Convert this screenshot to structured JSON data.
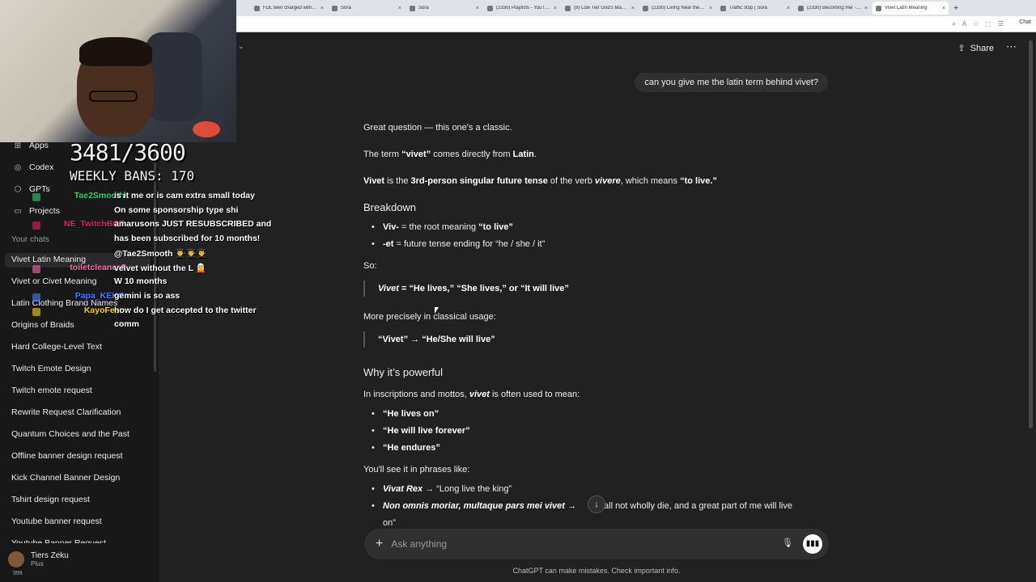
{
  "browser": {
    "tabs": [
      {
        "title": "FDL teen charged with cl…",
        "active": false
      },
      {
        "title": "Sora",
        "active": false
      },
      {
        "title": "Sora",
        "active": false
      },
      {
        "title": "(2330) Playlists - YouTube",
        "active": false
      },
      {
        "title": "(8) Low Tier God's Mansi…",
        "active": false
      },
      {
        "title": "(2330) Living Near the M…",
        "active": false
      },
      {
        "title": "Traffic stop | Sora",
        "active": false
      },
      {
        "title": "(2330) Becoming Her - Ca…",
        "active": false
      },
      {
        "title": "Vivet Latin Meaning",
        "active": true
      }
    ],
    "chat_button": "Chat"
  },
  "sidebar": {
    "nav": [
      {
        "label": "Apps",
        "icon": "apps-icon"
      },
      {
        "label": "Codex",
        "icon": "codex-icon"
      },
      {
        "label": "GPTs",
        "icon": "gpts-icon"
      },
      {
        "label": "Projects",
        "icon": "folder-icon"
      }
    ],
    "section_header": "Your chats",
    "chats": [
      "Vivet Latin Meaning",
      "Vivet or Civet Meaning",
      "Latin Clothing Brand Names",
      "Origins of Braids",
      "Hard College-Level Text",
      "Twitch Emote Design",
      "Twitch emote request",
      "Rewrite Request Clarification",
      "Quantum Choices and the Past",
      "Offline banner design request",
      "Kick Channel Banner Design",
      "Tshirt design request",
      "Youtube banner request",
      "Youtube Banner Request"
    ],
    "user": {
      "name": "Tiers Zeku",
      "plan": "Plus",
      "badge": "999"
    }
  },
  "overlay": {
    "ban_count": "3481/3600",
    "weekly_bans": "WEEKLY BANS: 170",
    "chat": [
      {
        "user": "Tae2Smooth",
        "color": "#33d17a",
        "text": "is it me or is cam extra small today"
      },
      {
        "user": "",
        "color": "#ffffff",
        "text": "On some sponsorship type shi"
      },
      {
        "user": "NE_TwitchBOT",
        "color": "#e0245e",
        "text": "amarusons JUST RESUBSCRIBED and"
      },
      {
        "user": "",
        "color": "#ffffff",
        "text": "has been subscribed for 10 months!"
      },
      {
        "user": "",
        "color": "#ffffff",
        "text": "@Tae2Smooth 👨‍🎓👨‍🎓👨‍🎓"
      },
      {
        "user": "toiletcleaner4",
        "color": "#ff69b4",
        "text": "velvet without the L 🧝"
      },
      {
        "user": "",
        "color": "#ffffff",
        "text": "W 10 months"
      },
      {
        "user": "Papa_KEKG",
        "color": "#4a7bff",
        "text": "gemini is so ass"
      },
      {
        "user": "KayoFeen",
        "color": "#f5d90a",
        "text": "how do I get accepted to the twitter"
      },
      {
        "user": "",
        "color": "#ffffff",
        "text": "comm"
      }
    ]
  },
  "main": {
    "share_label": "Share",
    "user_message": "can you give me the latin term behind vivet?",
    "answer": {
      "intro": "Great question — this one's a classic.",
      "term_pre": "The term ",
      "term_word": "“vivet”",
      "term_mid": " comes directly from ",
      "term_lang": "Latin",
      "term_post": ".",
      "def_word": "Vivet",
      "def_mid1": " is the ",
      "def_tense": "3rd-person singular future tense",
      "def_mid2": " of the verb ",
      "def_verb": "vivere",
      "def_mid3": ", which means ",
      "def_meaning": "“to live.”",
      "breakdown_heading": "Breakdown",
      "breakdown": [
        {
          "part": "Viv-",
          "text": " = the root meaning ",
          "bold": "“to live”"
        },
        {
          "part": "-et",
          "text": " = future tense ending for “he / she / it”",
          "bold": ""
        }
      ],
      "so_label": "So:",
      "quote1_word": "Vivet",
      "quote1_rest": " = “He lives,” “She lives,” or “It will live”",
      "precise_label": "More precisely in classical usage:",
      "quote2": "“Vivet” → “He/She will live”",
      "powerful_heading": "Why it’s powerful",
      "powerful_pre": "In inscriptions and mottos, ",
      "powerful_word": "vivet",
      "powerful_post": " is often used to mean:",
      "meanings": [
        "“He lives on”",
        "“He will live forever”",
        "“He endures”"
      ],
      "phrases_label": "You'll see it in phrases like:",
      "phrase1_latin": "Vivat Rex",
      "phrase1_rest": " → “Long live the king”",
      "phrase2_latin": "Non omnis moriar, multaque pars mei vivet →",
      "phrase2_rest": "all not wholly die, and a great part of me will live",
      "phrase2_wrap": "on”"
    },
    "composer_placeholder": "Ask anything",
    "disclaimer": "ChatGPT can make mistakes. Check important info."
  }
}
